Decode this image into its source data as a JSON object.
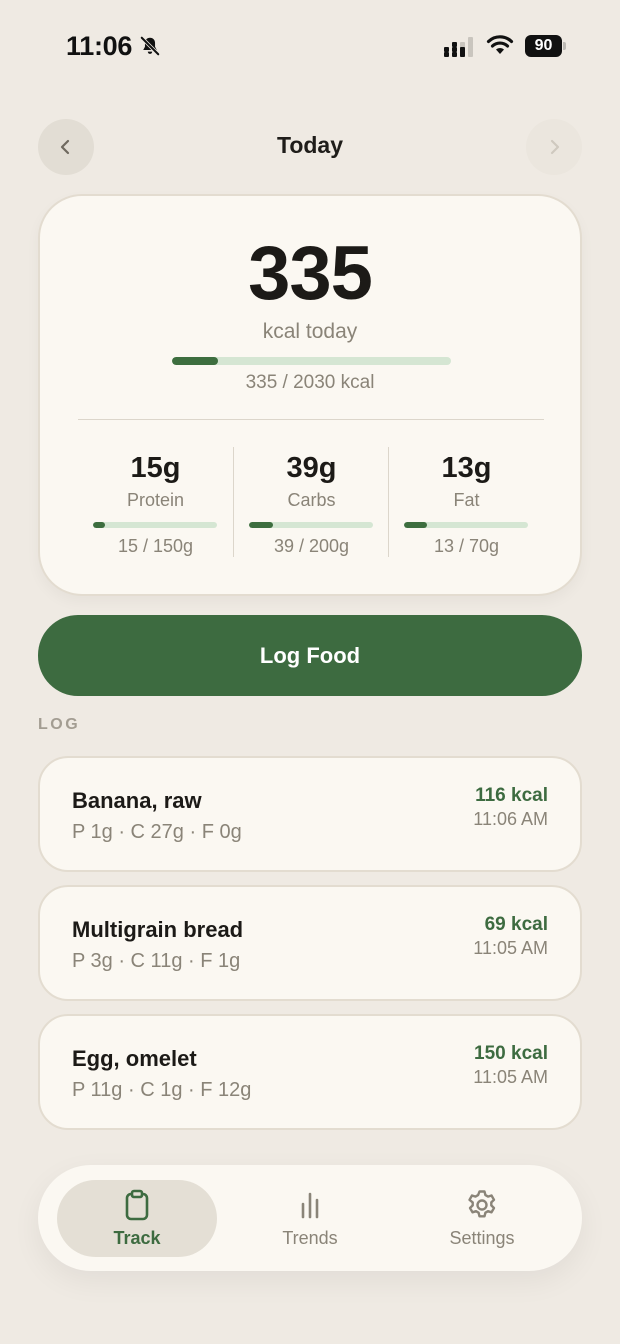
{
  "status_bar": {
    "time": "11:06",
    "battery": "90"
  },
  "header": {
    "title": "Today"
  },
  "summary": {
    "kcal": "335",
    "kcal_label": "kcal today",
    "kcal_progress_text": "335 / 2030 kcal",
    "kcal_fraction": 0.165,
    "macros": [
      {
        "value": "15g",
        "name": "Protein",
        "progress_text": "15 / 150g",
        "fraction": 0.1
      },
      {
        "value": "39g",
        "name": "Carbs",
        "progress_text": "39 / 200g",
        "fraction": 0.195
      },
      {
        "value": "13g",
        "name": "Fat",
        "progress_text": "13 / 70g",
        "fraction": 0.186
      }
    ]
  },
  "log_button": {
    "label": "Log Food"
  },
  "log": {
    "heading": "LOG",
    "entries": [
      {
        "name": "Banana, raw",
        "macros": "P 1g · C 27g · F 0g",
        "kcal": "116 kcal",
        "time": "11:06 AM"
      },
      {
        "name": "Multigrain bread",
        "macros": "P 3g · C 11g · F 1g",
        "kcal": "69 kcal",
        "time": "11:05 AM"
      },
      {
        "name": "Egg, omelet",
        "macros": "P 11g · C 1g · F 12g",
        "kcal": "150 kcal",
        "time": "11:05 AM"
      }
    ]
  },
  "tabs": [
    {
      "label": "Track",
      "icon": "clipboard-icon",
      "active": true
    },
    {
      "label": "Trends",
      "icon": "bar-chart-icon",
      "active": false
    },
    {
      "label": "Settings",
      "icon": "gear-icon",
      "active": false
    }
  ],
  "colors": {
    "accent": "#3d6b40",
    "background": "#efeae3",
    "card": "#fbf8f2",
    "track": "#d5e6d3"
  }
}
